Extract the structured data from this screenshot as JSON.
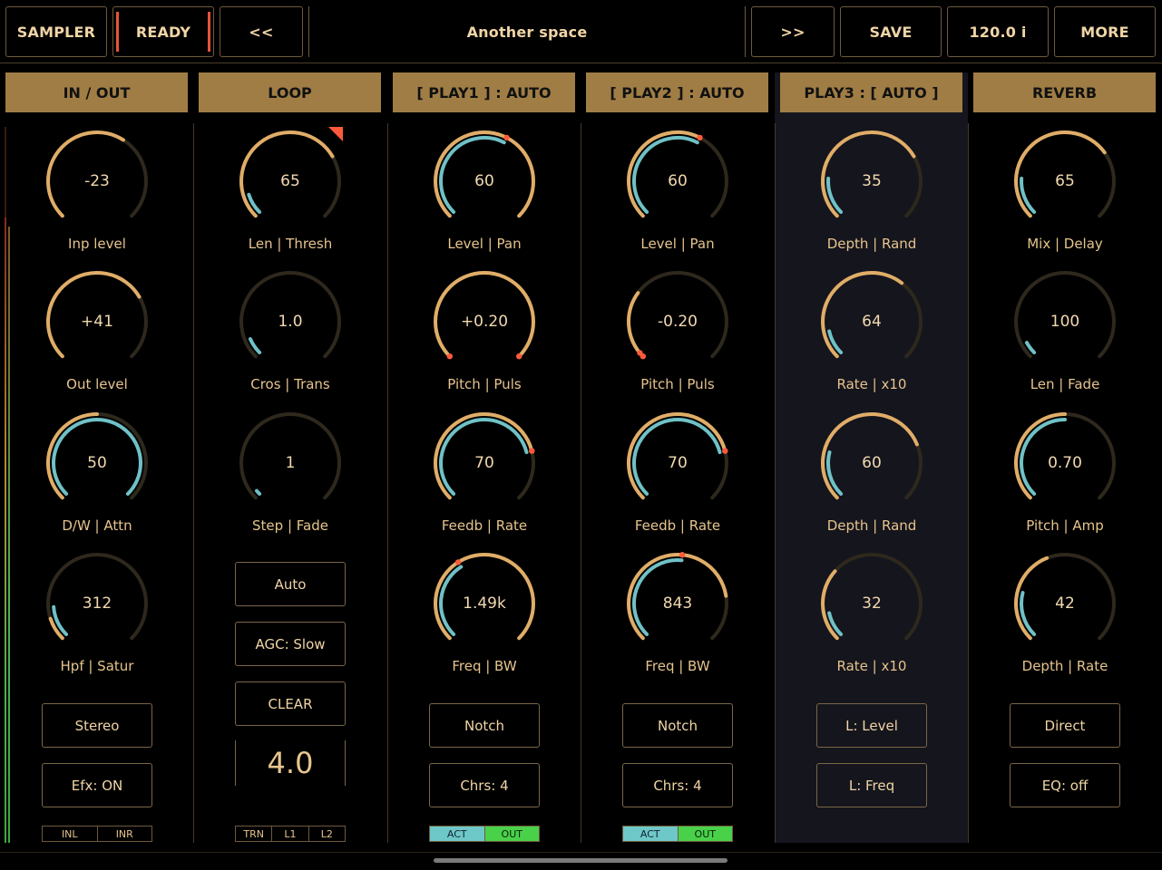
{
  "toolbar": {
    "sampler": "SAMPLER",
    "ready": "READY",
    "prev": "<<",
    "preset_name": "Another space",
    "next": ">>",
    "save": "SAVE",
    "tempo": "120.0 i",
    "more": "MORE"
  },
  "colors": {
    "accent_gold": "#a07d45",
    "knob_arc": "#e0ad68",
    "knob_mod": "#6fc1c6",
    "knob_marker": "#ff5a3c",
    "ready_bar": "#e8543a",
    "act": "#6fc8c8",
    "out": "#49d14a"
  },
  "columns": [
    {
      "title": "IN / OUT",
      "knobs": [
        {
          "value": "-23",
          "label": "Inp level",
          "level": 0.62,
          "mod": null
        },
        {
          "value": "+41",
          "label": "Out level",
          "level": 0.72,
          "mod": null
        },
        {
          "value": "50",
          "label": "D/W | Attn",
          "level": 0.5,
          "mod": 1.0
        },
        {
          "value": "312",
          "label": "Hpf | Satur",
          "level": 0.1,
          "mod": 0.15
        }
      ],
      "buttons": [
        "Stereo",
        "Efx: ON"
      ],
      "segments": [
        "INL",
        "INR"
      ]
    },
    {
      "title": "LOOP",
      "knobs": [
        {
          "value": "65",
          "label": "Len | Thresh",
          "level": 0.72,
          "mod": 0.1,
          "corner": true
        },
        {
          "value": "1.0",
          "label": "Cros | Trans",
          "level": 0.0,
          "mod": 0.08
        },
        {
          "value": "1",
          "label": "Step | Fade",
          "level": 0.0,
          "mod": 0.02
        },
        null
      ],
      "buttons": [
        "Auto",
        "AGC: Slow",
        "CLEAR"
      ],
      "display": "4.0",
      "segments": [
        "TRN",
        "L1",
        "L2"
      ]
    },
    {
      "title": "[ PLAY1 ] : AUTO",
      "knobs": [
        {
          "value": "60",
          "label": "Level | Pan",
          "level": 1.0,
          "mod": 0.6,
          "marker": 0.6
        },
        {
          "value": "+0.20",
          "label": "Pitch | Puls",
          "level": 1.0,
          "mod": null,
          "marker": 0.0,
          "marker2": 1.0
        },
        {
          "value": "70",
          "label": "Feedb | Rate",
          "level": 0.78,
          "mod": 0.78,
          "marker": 0.78
        },
        {
          "value": "1.49k",
          "label": "Freq | BW",
          "level": 1.0,
          "mod": 0.38,
          "marker": 0.38
        }
      ],
      "buttons": [
        "Notch",
        "Chrs: 4"
      ],
      "segments": [
        "ACT",
        "OUT"
      ]
    },
    {
      "title": "[ PLAY2 ] : AUTO",
      "knobs": [
        {
          "value": "60",
          "label": "Level | Pan",
          "level": 0.6,
          "mod": 0.6,
          "marker": 0.6
        },
        {
          "value": "-0.20",
          "label": "Pitch | Puls",
          "level": 0.3,
          "mod": null,
          "marker": 0.0,
          "marker2": 0.02
        },
        {
          "value": "70",
          "label": "Feedb | Rate",
          "level": 0.78,
          "mod": 0.78,
          "marker": 0.78
        },
        {
          "value": "843",
          "label": "Freq | BW",
          "level": 0.8,
          "mod": 0.52,
          "marker": 0.52
        }
      ],
      "buttons": [
        "Notch",
        "Chrs: 4"
      ],
      "segments": [
        "ACT",
        "OUT"
      ]
    },
    {
      "title": "PLAY3 : [ AUTO ]",
      "highlight": true,
      "knobs": [
        {
          "value": "35",
          "label": "Depth | Rand",
          "level": 0.72,
          "mod": 0.18
        },
        {
          "value": "64",
          "label": "Rate | x10",
          "level": 0.64,
          "mod": 0.12
        },
        {
          "value": "60",
          "label": "Depth | Rand",
          "level": 0.75,
          "mod": 0.22
        },
        {
          "value": "32",
          "label": "Rate | x10",
          "level": 0.32,
          "mod": 0.12
        }
      ],
      "buttons": [
        "L: Level",
        "L: Freq"
      ]
    },
    {
      "title": "REVERB",
      "knobs": [
        {
          "value": "65",
          "label": "Mix | Delay",
          "level": 0.7,
          "mod": 0.18
        },
        {
          "value": "100",
          "label": "Len | Fade",
          "level": 0.0,
          "mod": 0.06
        },
        {
          "value": "0.70",
          "label": "Pitch | Amp",
          "level": 0.5,
          "mod": 0.5
        },
        {
          "value": "42",
          "label": "Depth | Rate",
          "level": 0.42,
          "mod": 0.22
        }
      ],
      "buttons": [
        "Direct",
        "EQ: off"
      ]
    }
  ]
}
